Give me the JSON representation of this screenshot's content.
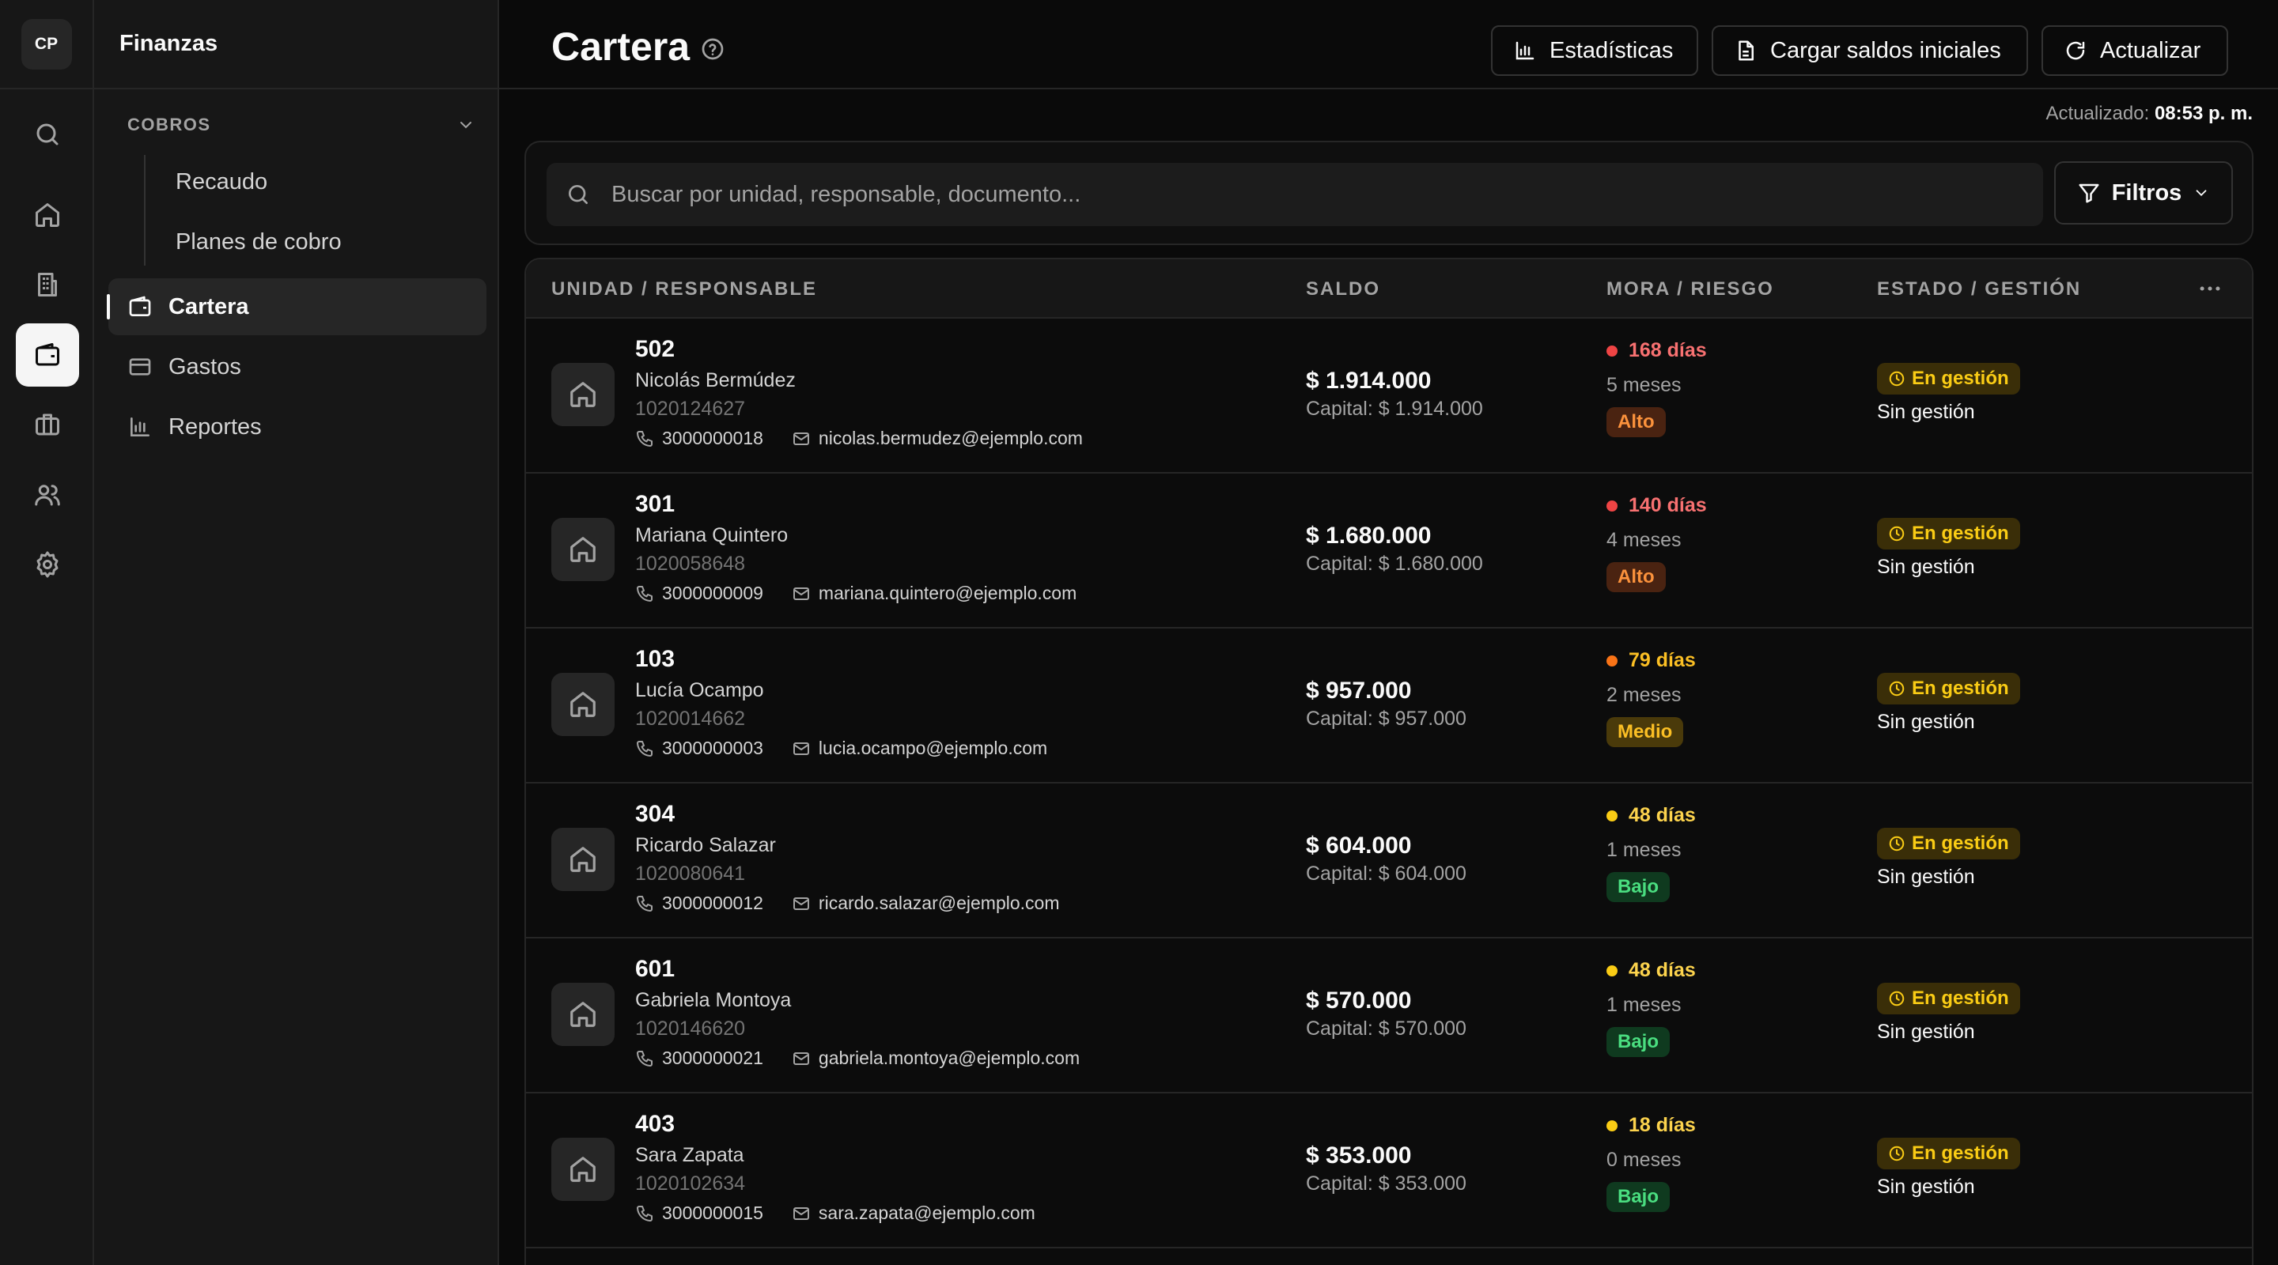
{
  "rail": {
    "logo": "CP"
  },
  "nav": {
    "title": "Finanzas",
    "group": "COBROS",
    "sub_items": [
      "Recaudo",
      "Planes de cobro"
    ],
    "items": [
      "Cartera",
      "Gastos",
      "Reportes"
    ]
  },
  "header": {
    "title": "Cartera",
    "buttons": {
      "stats": "Estadísticas",
      "load": "Cargar saldos iniciales",
      "refresh": "Actualizar"
    },
    "updated_label": "Actualizado:",
    "updated_time": "08:53 p. m."
  },
  "search": {
    "placeholder": "Buscar por unidad, responsable, documento...",
    "filters": "Filtros"
  },
  "table": {
    "headers": [
      "UNIDAD / RESPONSABLE",
      "SALDO",
      "MORA / RIESGO",
      "ESTADO / GESTIÓN"
    ],
    "rows": [
      {
        "unit": "502",
        "name": "Nicolás Bermúdez",
        "doc": "1020124627",
        "phone": "3000000018",
        "email": "nicolas.bermudez@ejemplo.com",
        "saldo": "$ 1.914.000",
        "capital": "Capital: $ 1.914.000",
        "mora": "168 días",
        "meses": "5 meses",
        "riesgo": "Alto",
        "estado": "En gestión",
        "gestion": "Sin gestión"
      },
      {
        "unit": "301",
        "name": "Mariana Quintero",
        "doc": "1020058648",
        "phone": "3000000009",
        "email": "mariana.quintero@ejemplo.com",
        "saldo": "$ 1.680.000",
        "capital": "Capital: $ 1.680.000",
        "mora": "140 días",
        "meses": "4 meses",
        "riesgo": "Alto",
        "estado": "En gestión",
        "gestion": "Sin gestión"
      },
      {
        "unit": "103",
        "name": "Lucía Ocampo",
        "doc": "1020014662",
        "phone": "3000000003",
        "email": "lucia.ocampo@ejemplo.com",
        "saldo": "$ 957.000",
        "capital": "Capital: $ 957.000",
        "mora": "79 días",
        "meses": "2 meses",
        "riesgo": "Medio",
        "estado": "En gestión",
        "gestion": "Sin gestión"
      },
      {
        "unit": "304",
        "name": "Ricardo Salazar",
        "doc": "1020080641",
        "phone": "3000000012",
        "email": "ricardo.salazar@ejemplo.com",
        "saldo": "$ 604.000",
        "capital": "Capital: $ 604.000",
        "mora": "48 días",
        "meses": "1 meses",
        "riesgo": "Bajo",
        "estado": "En gestión",
        "gestion": "Sin gestión"
      },
      {
        "unit": "601",
        "name": "Gabriela Montoya",
        "doc": "1020146620",
        "phone": "3000000021",
        "email": "gabriela.montoya@ejemplo.com",
        "saldo": "$ 570.000",
        "capital": "Capital: $ 570.000",
        "mora": "48 días",
        "meses": "1 meses",
        "riesgo": "Bajo",
        "estado": "En gestión",
        "gestion": "Sin gestión"
      },
      {
        "unit": "403",
        "name": "Sara Zapata",
        "doc": "1020102634",
        "phone": "3000000015",
        "email": "sara.zapata@ejemplo.com",
        "saldo": "$ 353.000",
        "capital": "Capital: $ 353.000",
        "mora": "18 días",
        "meses": "0 meses",
        "riesgo": "Bajo",
        "estado": "En gestión",
        "gestion": "Sin gestión"
      }
    ]
  },
  "colors": {
    "mora_alto": "#f87171",
    "dot_alto": "#ef4444",
    "mora_medio": "#fbbf24",
    "dot_medio": "#f97316",
    "mora_bajo": "#fcd34d",
    "dot_bajo": "#facc15",
    "risk_alto_bg": "#4a2311",
    "risk_alto_fg": "#fb923c",
    "risk_medio_bg": "#4a3a0a",
    "risk_medio_fg": "#fbbf24",
    "risk_bajo_bg": "#0f3a1f",
    "risk_bajo_fg": "#4ade80"
  }
}
